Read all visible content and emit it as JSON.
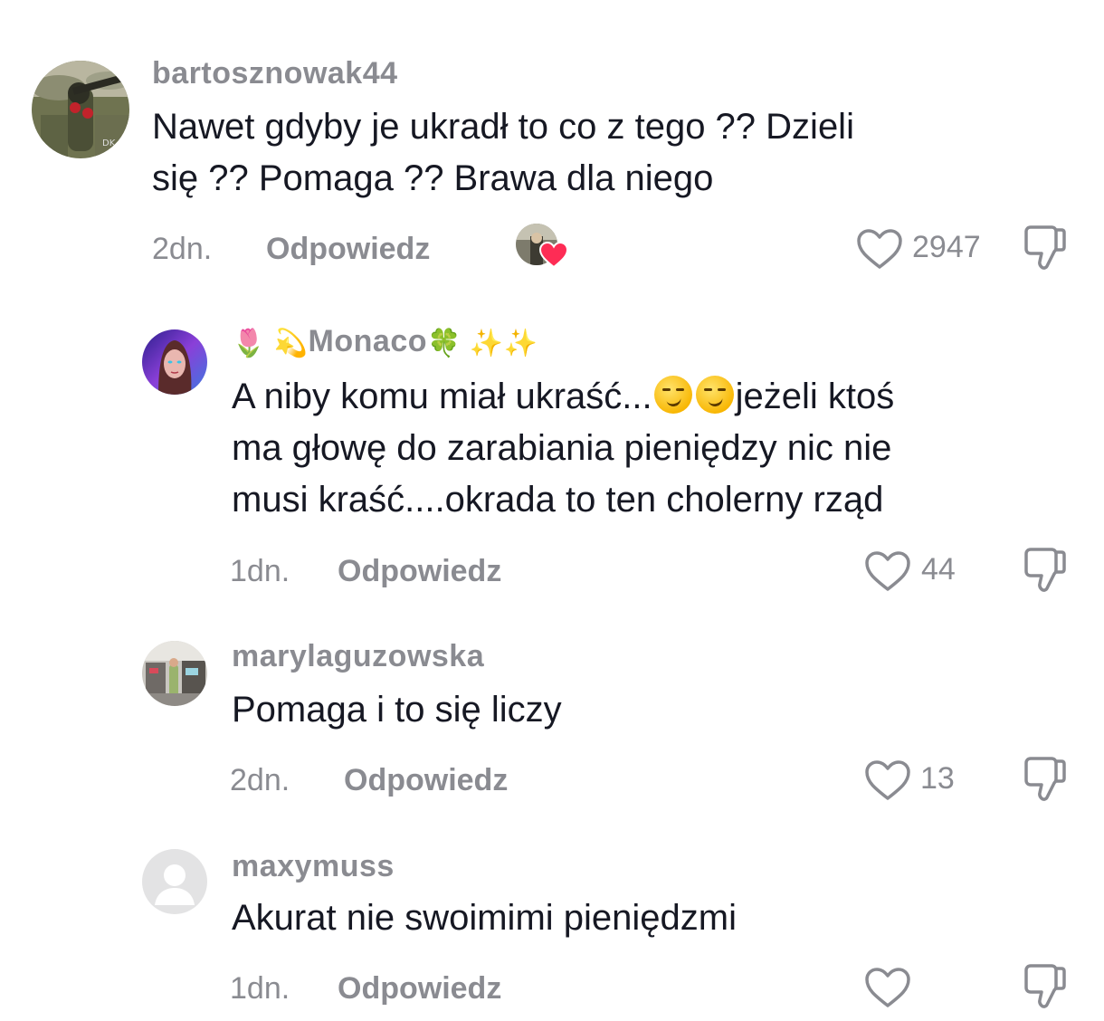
{
  "comments": [
    {
      "username": "bartosznowak44",
      "text": "Nawet gdyby je ukradł to co z tego ?? Dzieli\nsię ?? Pomaga ?? Brawa dla niego",
      "time": "2dn.",
      "reply_label": "Odpowiedz",
      "like_count": "2947"
    },
    {
      "username_emoji_prefix": "🌷 💫",
      "username": "Monaco",
      "username_emoji_suffix": "🍀 ✨✨",
      "text_part1": "A niby komu miał ukraść...",
      "text_part2": "jeżeli ktoś\nma głowę do zarabiania pieniędzy nic nie\nmusi kraść....okrada to ten cholerny rząd",
      "time": "1dn.",
      "reply_label": "Odpowiedz",
      "like_count": "44"
    },
    {
      "username": "marylaguzowska",
      "text": "Pomaga i to się liczy",
      "time": "2dn.",
      "reply_label": "Odpowiedz",
      "like_count": "13"
    },
    {
      "username": "maxymuss",
      "text": "Akurat nie swoimimi pieniędzmi",
      "time": "1dn.",
      "reply_label": "Odpowiedz",
      "like_count": ""
    }
  ],
  "colors": {
    "secondary_text": "#8a8b91",
    "primary_text": "#161823",
    "creator_like_heart": "#fe2c55"
  },
  "icons": [
    "heart-outline-icon",
    "dislike-icon",
    "creator-liked-heart-icon",
    "default-avatar-icon"
  ]
}
